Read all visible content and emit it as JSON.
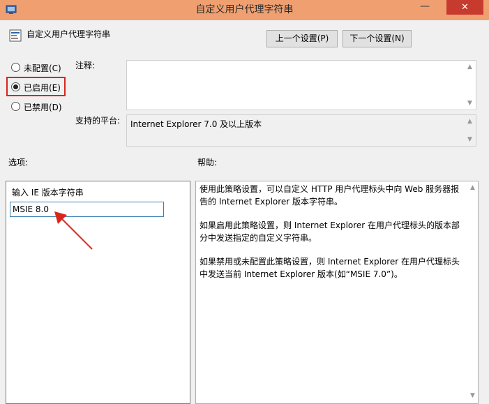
{
  "window": {
    "title": "自定义用户代理字符串",
    "close_glyph": "✕",
    "minimize_glyph": "—"
  },
  "header": {
    "setting_name": "自定义用户代理字符串"
  },
  "nav": {
    "prev_label": "上一个设置(P)",
    "next_label": "下一个设置(N)"
  },
  "options": {
    "not_configured": "未配置(C)",
    "enabled": "已启用(E)",
    "disabled": "已禁用(D)",
    "selected": "enabled"
  },
  "comment": {
    "label": "注释:",
    "value": ""
  },
  "platform": {
    "label": "支持的平台:",
    "value": "Internet Explorer 7.0 及以上版本"
  },
  "sections": {
    "options_label": "选项:",
    "help_label": "帮助:"
  },
  "option_panel": {
    "field_label": "输入 IE 版本字符串",
    "field_value": "MSIE 8.0"
  },
  "help": {
    "paragraphs": [
      "使用此策略设置，可以自定义 HTTP 用户代理标头中向 Web 服务器报告的 Internet Explorer 版本字符串。",
      "如果启用此策略设置，则 Internet Explorer 在用户代理标头的版本部分中发送指定的自定义字符串。",
      "如果禁用或未配置此策略设置，则 Internet Explorer 在用户代理标头中发送当前 Internet Explorer 版本(如“MSIE 7.0”)。"
    ]
  },
  "colors": {
    "titlebar": "#f0a070",
    "close": "#c73a2e",
    "highlight": "#d9261c",
    "arrow": "#d9261c"
  }
}
